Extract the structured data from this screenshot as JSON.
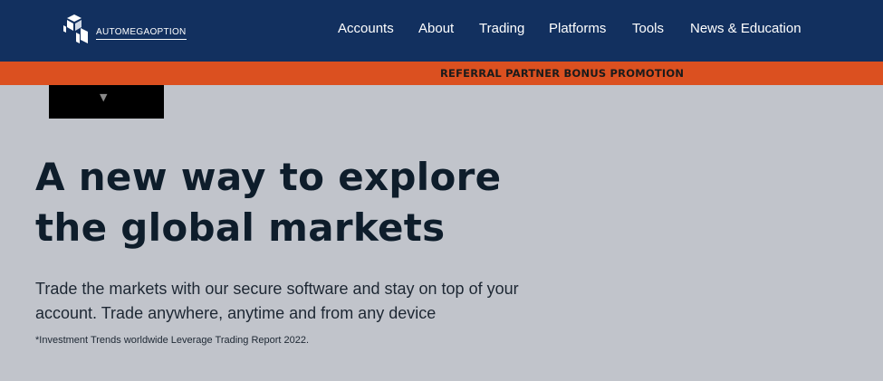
{
  "header": {
    "logo_text": "AUTOMEGAOPTION",
    "logo_icon": "cube-logo-icon",
    "background_color": "#12305f"
  },
  "nav": {
    "items": [
      {
        "label": "Accounts"
      },
      {
        "label": "About"
      },
      {
        "label": "Trading"
      },
      {
        "label": "Platforms"
      },
      {
        "label": "Tools"
      },
      {
        "label": "News & Education"
      }
    ]
  },
  "promo": {
    "text": "REFERRAL PARTNER BONUS PROMOTION",
    "color": "#db5020"
  },
  "dropdown": {
    "icon": "caret-down-icon",
    "arrow": "▼"
  },
  "hero": {
    "title_line1": "A new way to explore",
    "title_line2": "the global markets",
    "subtitle_line1": "Trade the markets with our secure software and stay on top of your",
    "subtitle_line2": "account. Trade anywhere, anytime and from any device",
    "footnote": "*Investment Trends worldwide Leverage Trading Report 2022."
  }
}
